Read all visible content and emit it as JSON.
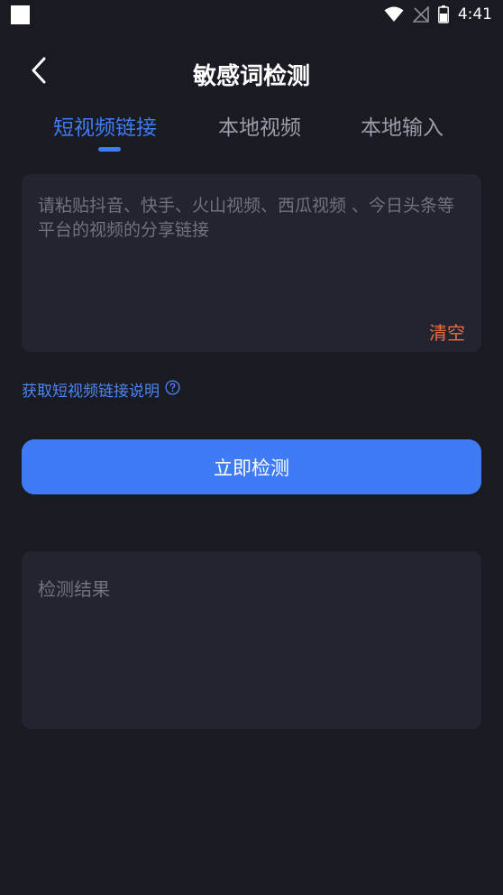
{
  "status_bar": {
    "time": "4:41",
    "icons": [
      "notification-square-icon",
      "wifi-icon",
      "no-signal-icon",
      "battery-icon"
    ]
  },
  "header": {
    "back_icon": "chevron-left-icon",
    "title": "敏感词检测"
  },
  "tabs": [
    {
      "label": "短视频链接",
      "active": true
    },
    {
      "label": "本地视频",
      "active": false
    },
    {
      "label": "本地输入",
      "active": false
    }
  ],
  "link_input": {
    "value": "",
    "placeholder": "请粘贴抖音、快手、火山视频、西瓜视频 、今日头条等平台的视频的分享链接",
    "clear_label": "清空"
  },
  "help": {
    "label": "获取短视频链接说明",
    "icon": "question-circle-icon"
  },
  "detect_button": {
    "label": "立即检测"
  },
  "result": {
    "placeholder": "检测结果"
  },
  "colors": {
    "background": "#191a22",
    "card": "#23242f",
    "accent": "#3f7bf4",
    "clear": "#f26a3e",
    "muted": "#70727e"
  }
}
